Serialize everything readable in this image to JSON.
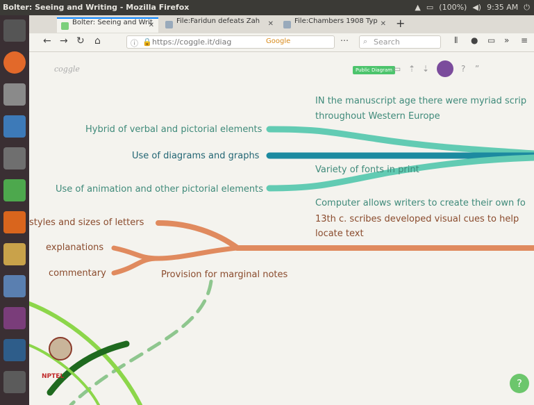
{
  "os": {
    "window_title": "Bolter: Seeing and Writing - Mozilla Firefox",
    "battery": "(100%)",
    "time": "9:35 AM"
  },
  "browser": {
    "tabs": [
      {
        "label": "Bolter: Seeing and Writ"
      },
      {
        "label": "File:Faridun defeats Zah"
      },
      {
        "label": "File:Chambers 1908 Typ"
      }
    ],
    "url": "https://coggle.it/diag",
    "search_engine": "Google",
    "search_placeholder": "Search"
  },
  "app": {
    "logo": "coggle",
    "badge": "Public Diagram"
  },
  "mindmap": {
    "teal_left": [
      "Hybrid of verbal and pictorial elements",
      "Use of diagrams and graphs",
      "Use of animation and other pictorial elements"
    ],
    "teal_right": [
      "IN the manuscript age there were myriad scrip",
      "throughout Western Europe",
      "Variety of fonts in print",
      "Computer allows writers to create their own fo"
    ],
    "orange_left": [
      "styles and sizes of letters",
      "explanations",
      "commentary"
    ],
    "orange_right": [
      "13th c. scribes developed visual cues to help",
      "locate text"
    ],
    "orange_mid": "Provision for marginal notes"
  },
  "footer": {
    "watermark": "NPTEL",
    "help": "?"
  },
  "colors": {
    "teal": "#62cbb3",
    "dark_teal": "#1c8aa0",
    "orange": "#e08a5e",
    "green": "#2a8a2a"
  }
}
